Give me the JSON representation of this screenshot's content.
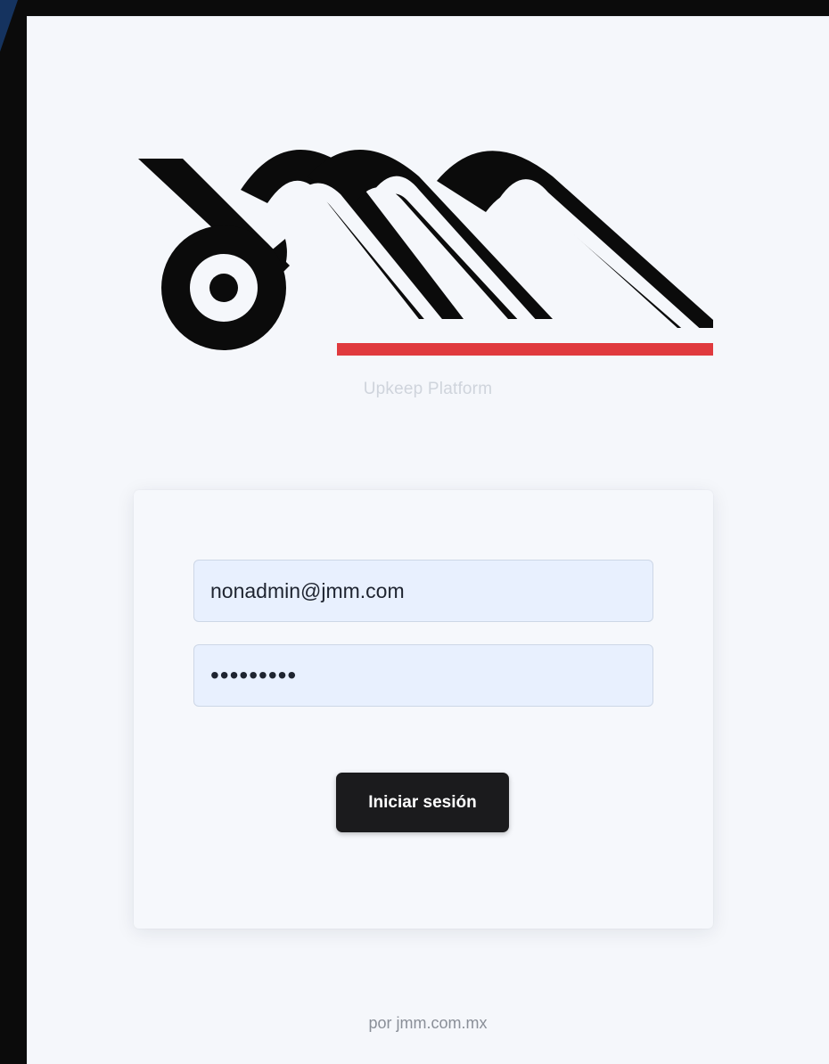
{
  "brand": {
    "logo_text": "JMM",
    "subtitle": "Upkeep Platform",
    "accent_color": "#e03a3e",
    "logo_color": "#0b0b0b"
  },
  "login": {
    "email_value": "nonadmin@jmm.com",
    "password_value": "•••••••••",
    "submit_label": "Iniciar sesión"
  },
  "footer": {
    "text": "por jmm.com.mx"
  }
}
